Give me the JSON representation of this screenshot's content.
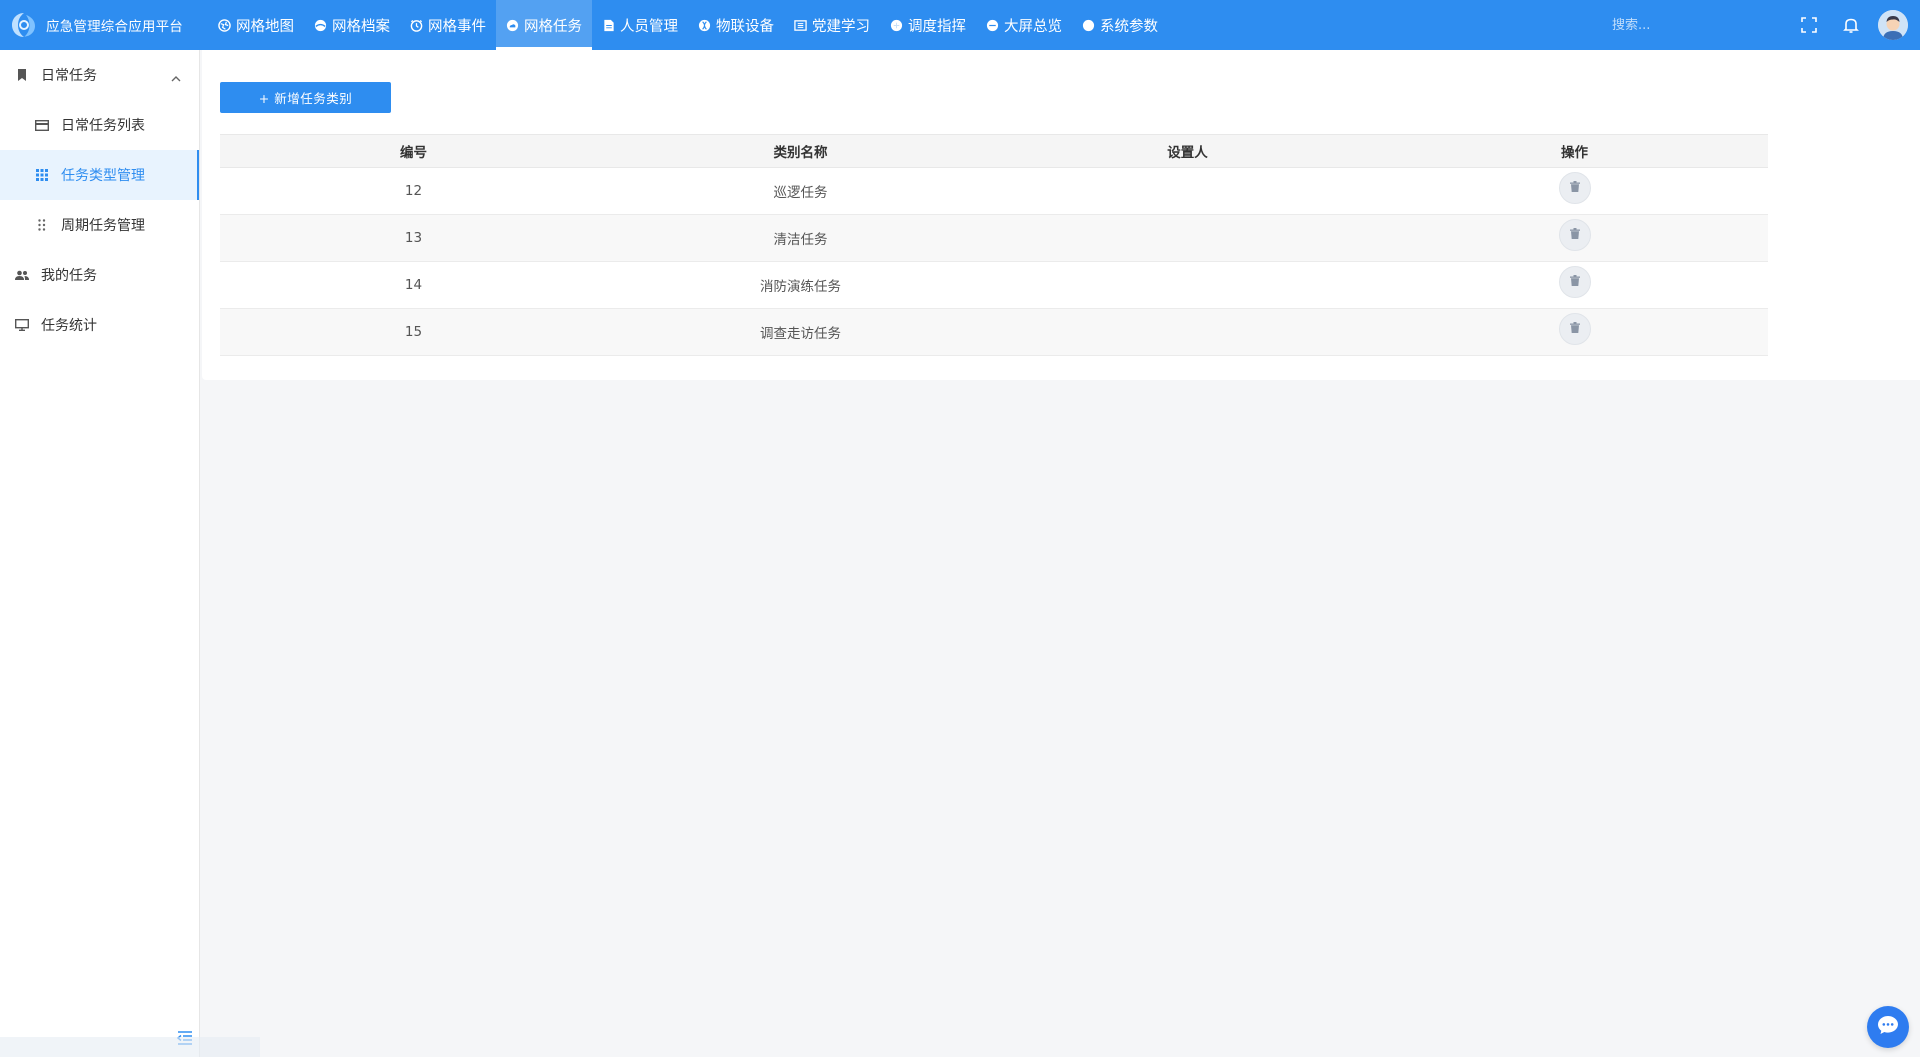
{
  "app": {
    "title": "应急管理综合应用平台"
  },
  "nav": {
    "items": [
      {
        "label": "网格地图",
        "icon": "globe-icon"
      },
      {
        "label": "网格档案",
        "icon": "archive-icon"
      },
      {
        "label": "网格事件",
        "icon": "event-icon"
      },
      {
        "label": "网格任务",
        "icon": "cloud-icon",
        "active": true
      },
      {
        "label": "人员管理",
        "icon": "document-icon"
      },
      {
        "label": "物联设备",
        "icon": "device-icon"
      },
      {
        "label": "党建学习",
        "icon": "book-icon"
      },
      {
        "label": "调度指挥",
        "icon": "dispatch-icon"
      },
      {
        "label": "大屏总览",
        "icon": "screen-icon"
      },
      {
        "label": "系统参数",
        "icon": "settings-icon"
      }
    ]
  },
  "search": {
    "placeholder": "搜索..."
  },
  "sidebar": {
    "items": [
      {
        "label": "日常任务",
        "icon": "bookmark-icon",
        "level": 1,
        "expanded": true
      },
      {
        "label": "日常任务列表",
        "icon": "card-icon",
        "level": 2
      },
      {
        "label": "任务类型管理",
        "icon": "grid-icon",
        "level": 2,
        "active": true
      },
      {
        "label": "周期任务管理",
        "icon": "dots-icon",
        "level": 2
      },
      {
        "label": "我的任务",
        "icon": "users-icon",
        "level": 1
      },
      {
        "label": "任务统计",
        "icon": "monitor-icon",
        "level": 1
      }
    ]
  },
  "toolbar": {
    "add_label": "+ 新增任务类别"
  },
  "table": {
    "headers": [
      "编号",
      "类别名称",
      "设置人",
      "操作"
    ],
    "rows": [
      {
        "id": "12",
        "name": "巡逻任务",
        "setter": ""
      },
      {
        "id": "13",
        "name": "清洁任务",
        "setter": ""
      },
      {
        "id": "14",
        "name": "消防演练任务",
        "setter": ""
      },
      {
        "id": "15",
        "name": "调查走访任务",
        "setter": ""
      }
    ]
  },
  "colors": {
    "primary": "#2e8df0",
    "active_bg": "#e8f3fe"
  }
}
